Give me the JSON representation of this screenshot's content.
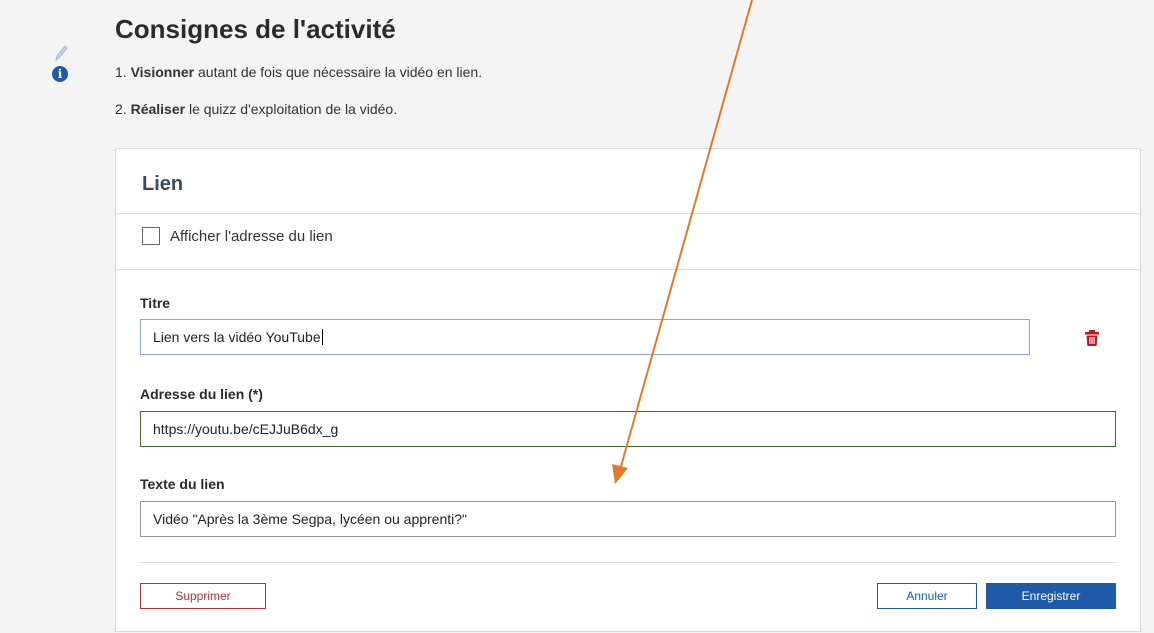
{
  "page": {
    "heading": "Consignes de l'activité",
    "steps": [
      {
        "number": "1.",
        "bold": "Visionner",
        "rest": " autant de fois que nécessaire la vidéo en lien."
      },
      {
        "number": "2.",
        "bold": "Réaliser",
        "rest": " le quizz d'exploitation de la vidéo."
      }
    ],
    "icons": {
      "edit": "pencil-icon",
      "info": "info-icon"
    }
  },
  "card": {
    "title": "Lien",
    "show_address_checkbox": {
      "label": "Afficher l'adresse du lien",
      "checked": false
    },
    "fields": {
      "title": {
        "label": "Titre",
        "value": "Lien vers la vidéo YouTube"
      },
      "address": {
        "label": "Adresse du lien (*)",
        "value": "https://youtu.be/cEJJuB6dx_g"
      },
      "text": {
        "label": "Texte du lien",
        "value": "Vidéo \"Après la 3ème Segpa, lycéen ou apprenti?\""
      }
    },
    "buttons": {
      "delete": "Supprimer",
      "cancel": "Annuler",
      "save": "Enregistrer"
    }
  },
  "colors": {
    "primary": "#1f5aa6",
    "danger": "#b03040",
    "trash": "#c0141e",
    "valid_border": "#3f6f2a",
    "annotation_arrow": "#e07a2a"
  }
}
